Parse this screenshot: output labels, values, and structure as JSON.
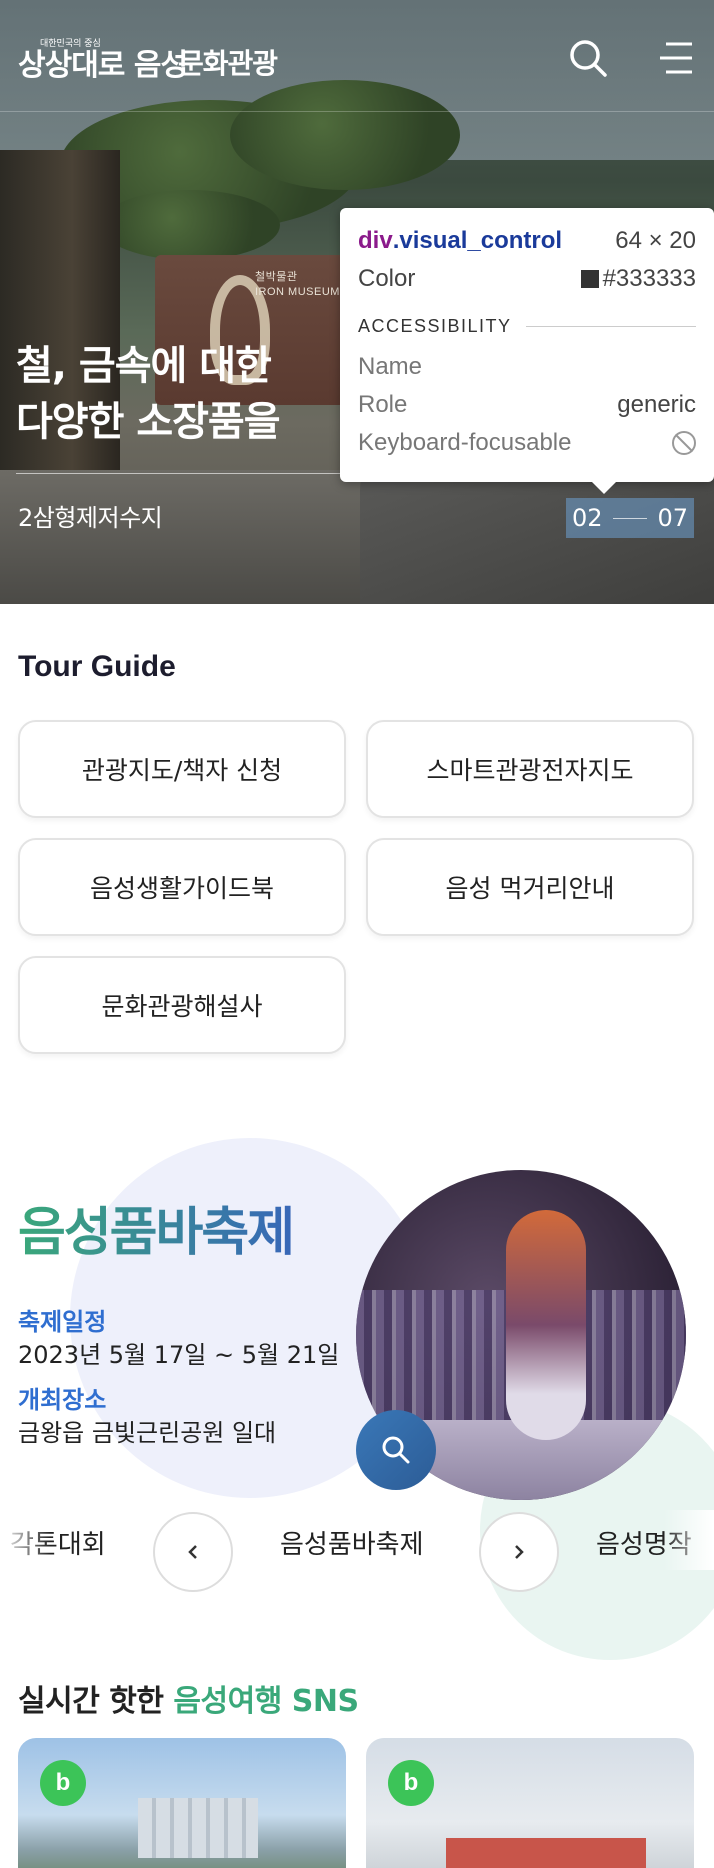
{
  "header": {
    "logo_small": "대한민국의 중심",
    "logo_main": "상상대로 음성",
    "logo_sub": "문화관광",
    "search_icon": "search-icon",
    "menu_icon": "menu-icon"
  },
  "hero": {
    "title_line1": "철, 금속에 대한",
    "title_line2": "다양한 소장품을",
    "place": "2삼형제저수지",
    "sign_line1": "철박물관",
    "sign_line2": "IRON MUSEUM",
    "current": "02",
    "total": "07"
  },
  "tooltip": {
    "selector_tag": "div",
    "selector_class": ".visual_control",
    "size": "64 × 20",
    "color_label": "Color",
    "color_value": "#333333",
    "section": "ACCESSIBILITY",
    "name_label": "Name",
    "name_value": "",
    "role_label": "Role",
    "role_value": "generic",
    "focus_label": "Keyboard-focusable"
  },
  "tour_guide": {
    "title": "Tour Guide",
    "buttons": [
      "관광지도/책자 신청",
      "스마트관광전자지도",
      "음성생활가이드북",
      "음성 먹거리안내",
      "문화관광해설사"
    ]
  },
  "festival": {
    "title": "음성품바축제",
    "schedule_label": "축제일정",
    "schedule_value": "2023년 5월 17일 ~ 5월 21일",
    "venue_label": "개최장소",
    "venue_value": "금왕읍 금빛근린공원 일대",
    "carousel": [
      "각톤대회",
      "음성품바축제",
      "음성명작"
    ]
  },
  "sns": {
    "title_plain": "실시간 핫한 ",
    "title_accent": "음성여행 SNS",
    "badge": "b"
  },
  "colors": {
    "accent_green": "#3aa87a",
    "accent_blue": "#2f6ed0",
    "control_bg": "#6ea0d2"
  }
}
